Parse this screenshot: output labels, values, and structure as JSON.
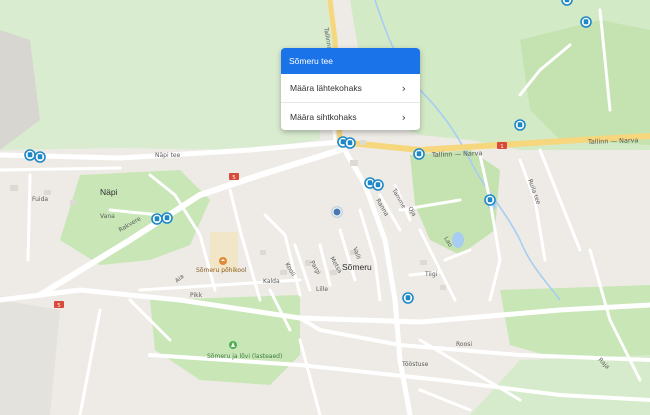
{
  "context_menu": {
    "title": "Sõmeru tee",
    "items": [
      {
        "label": "Määra lähtekohaks",
        "icon": "chevron-right-icon"
      },
      {
        "label": "Määra sihtkohaks",
        "icon": "chevron-right-icon"
      }
    ]
  },
  "map": {
    "places": {
      "town": "Sõmeru",
      "village": "Näpi",
      "road_label": "Tallinn — Narva",
      "road_label_2": "Tallinn — Narva",
      "school": "Sõmeru põhikool",
      "park": "Sõmeru ja lõvi (lasteaed)"
    },
    "roads": {
      "tallinna": "Tallinna",
      "napi_tee": "Näpi tee",
      "rakvere": "Rakvere",
      "fuida": "Fuida",
      "vana": "Vana",
      "kalda": "Kalda",
      "aia": "Aia",
      "pikk": "Pikk",
      "lille": "Lille",
      "kooli": "Kooli",
      "pargi": "Pargi",
      "metsa": "Metsa",
      "valli": "Valli",
      "ranna": "Ranna",
      "tamme": "Tamme",
      "oja": "Oja",
      "tiigi": "Tiigi",
      "lao": "Lao",
      "tooste": "Tööstuse",
      "ruila": "Ruila tee",
      "roosi": "Roosi",
      "raja": "Raja"
    },
    "shields": {
      "s1": "5",
      "s2": "5",
      "s3": "1"
    },
    "colors": {
      "land": "#eeebe6",
      "park": "#c8e6b6",
      "road": "#ffffff",
      "highway": "#f6d77d",
      "water": "#a7cdf2",
      "transit": "#1e88c7",
      "menu_header": "#1a73e8"
    }
  }
}
